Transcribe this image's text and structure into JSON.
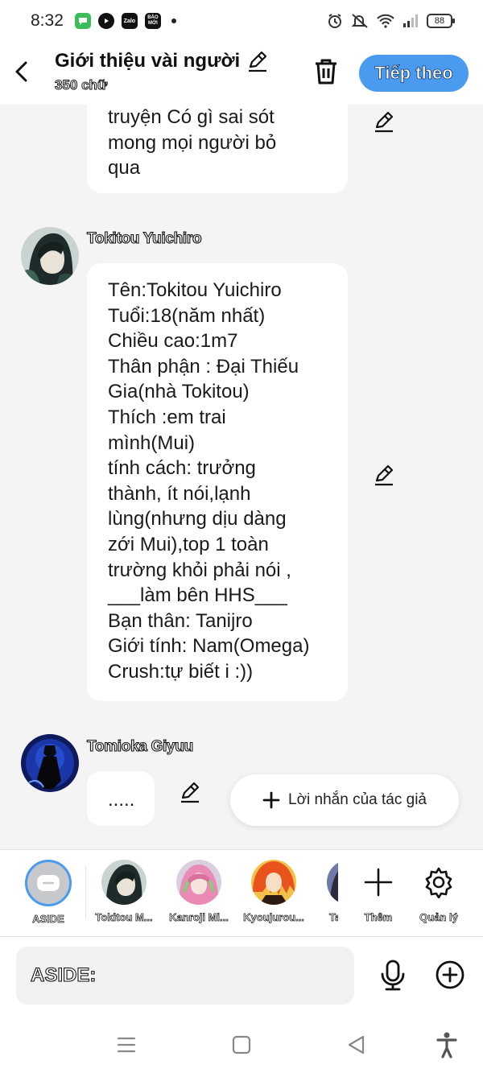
{
  "status_bar": {
    "time": "8:32",
    "apps": [
      {
        "name": "messages-app-icon",
        "color": "#3bbd5a",
        "label": ""
      },
      {
        "name": "youtube-app-icon",
        "color": "#111111",
        "label": ""
      },
      {
        "name": "zalo-app-icon",
        "color": "#111111",
        "label": "Zalo"
      },
      {
        "name": "baomoi-app-icon",
        "color": "#111111",
        "label": "BÁO MỚI"
      }
    ],
    "battery": "88"
  },
  "header": {
    "title": "Giới thiệu vài người",
    "char_count": "350 chữ",
    "next_label": "Tiếp theo"
  },
  "messages": {
    "first_bubble_text": "truyện Có gì sai sót\nmong mọi người bỏ\nqua",
    "tokitou": {
      "name": "Tokitou Yuichiro",
      "text": "Tên:Tokitou Yuichiro\nTuổi:18(năm nhất)\nChiều cao:1m7\nThân phận : Đại Thiếu\nGia(nhà Tokitou)\nThích :em trai\nmình(Mui)\ntính cách: trưởng\nthành, ít nói,lạnh\nlùng(nhưng dịu dàng\nzới Mui),top 1 toàn\ntrường khỏi phải nói ,\n___làm bên HHS___\nBạn thân: Tanijro\nGiới tính: Nam(Omega)\nCrush:tự biết i :))"
    },
    "tomioka": {
      "name": "Tomioka Giyuu",
      "text": "....."
    }
  },
  "author_note_label": "Lời nhắn của tác giả",
  "character_bar": {
    "items": [
      {
        "label": "ASIDE"
      },
      {
        "label": "Tokitou M..."
      },
      {
        "label": "Kanroji Mi..."
      },
      {
        "label": "Kyoujurou..."
      },
      {
        "label": "Ta"
      }
    ],
    "add_label": "Thêm",
    "manage_label": "Quản lý"
  },
  "input": {
    "prefix": "ASIDE:"
  }
}
